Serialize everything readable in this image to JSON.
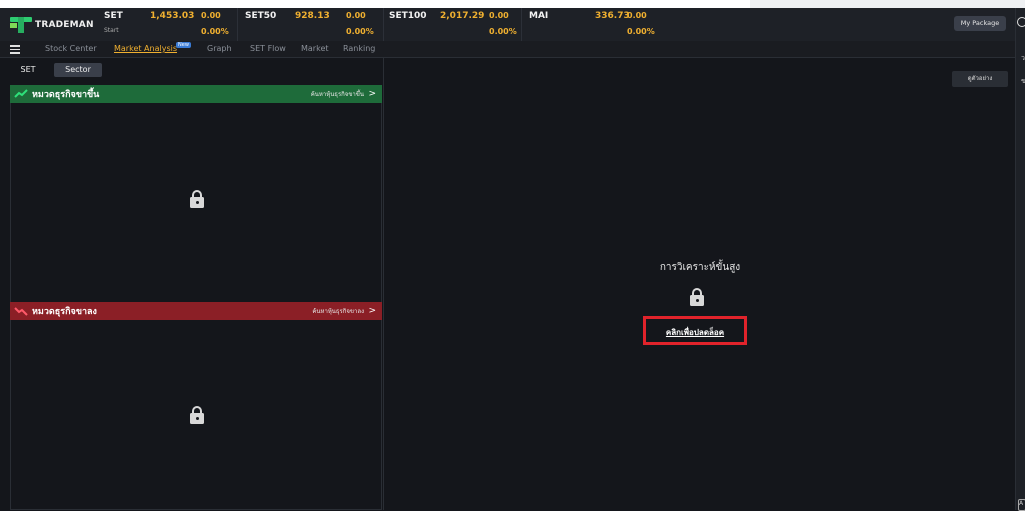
{
  "app": {
    "brand": "TRADEMAN"
  },
  "indices": [
    {
      "name": "SET",
      "sub": "Start",
      "value": "1,453.03",
      "change": "0.00",
      "pct": "0.00%"
    },
    {
      "name": "SET50",
      "sub": "",
      "value": "928.13",
      "change": "0.00",
      "pct": "0.00%"
    },
    {
      "name": "SET100",
      "sub": "",
      "value": "2,017.29",
      "change": "0.00",
      "pct": "0.00%"
    },
    {
      "name": "MAI",
      "sub": "",
      "value": "336.73",
      "change": "0.00",
      "pct": "0.00%"
    }
  ],
  "header": {
    "package_label": "My Package"
  },
  "nav": {
    "items": [
      {
        "label": "Stock Center",
        "active": false
      },
      {
        "label": "Market Analysis",
        "active": true
      },
      {
        "label": "Graph",
        "active": false
      },
      {
        "label": "SET Flow",
        "active": false
      },
      {
        "label": "Market",
        "active": false
      },
      {
        "label": "Ranking",
        "active": false
      }
    ],
    "new_badge": "New"
  },
  "subtabs": {
    "set": "SET",
    "sector": "Sector"
  },
  "sections": {
    "up": {
      "title": "หมวดธุรกิจขาขึ้น",
      "link": "ค้นหาหุ้นธุรกิจขาขึ้น",
      "chevron": ">"
    },
    "down": {
      "title": "หมวดธุรกิจขาลง",
      "link": "ค้นหาหุ้นธุรกิจขาลง",
      "chevron": ">"
    }
  },
  "right": {
    "example_label": "ดูตัวอย่าง",
    "advanced_title": "การวิเคราะห์ขั้นสูง",
    "unlock_label": "คลิกเพื่อปลดล็อค"
  },
  "colors": {
    "accent": "#f0b030",
    "up": "#1e6b3a",
    "down": "#8b1f26",
    "highlight": "#e0232b"
  },
  "sidebar_right": {
    "glyph1": "ว",
    "glyph2": "ข",
    "glyph3": "A"
  }
}
